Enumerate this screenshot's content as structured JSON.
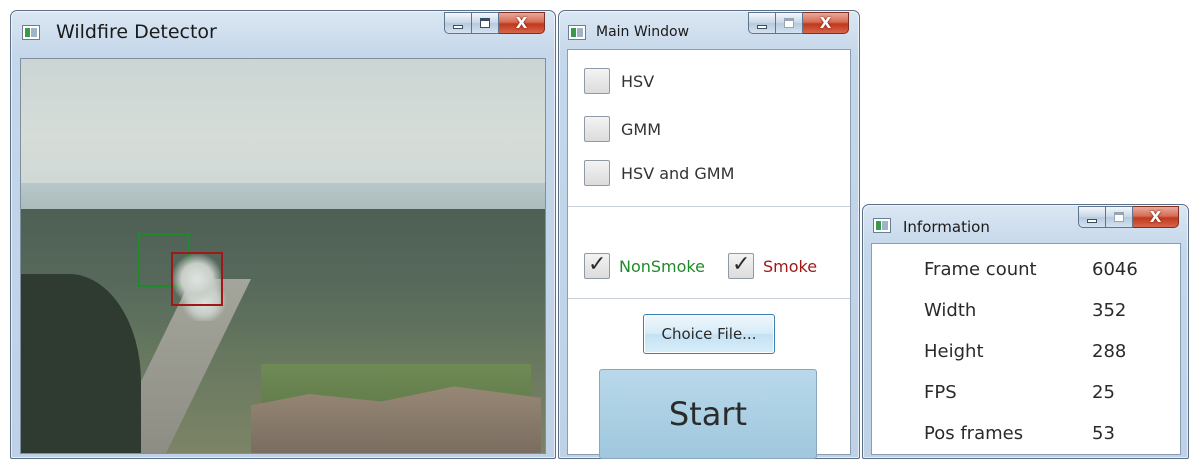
{
  "detector_window": {
    "title": "Wildfire Detector",
    "icon": "app-icon",
    "controls": [
      "minimize-icon",
      "maximize-icon",
      "close-icon"
    ],
    "close_glyph": "X",
    "detections": [
      {
        "label": "nonsmoke",
        "color": "#1f8a2b"
      },
      {
        "label": "smoke",
        "color": "#a01818"
      }
    ]
  },
  "main_window": {
    "title": "Main Window",
    "close_glyph": "X",
    "methods": [
      {
        "label": "HSV",
        "checked": false
      },
      {
        "label": "GMM",
        "checked": false
      },
      {
        "label": "HSV and GMM",
        "checked": false
      }
    ],
    "filters": [
      {
        "label": "NonSmoke",
        "checked": true,
        "color": "#1f8a2b"
      },
      {
        "label": "Smoke",
        "checked": true,
        "color": "#a01818"
      }
    ],
    "choice_button": "Choice File...",
    "start_button": "Start"
  },
  "info_window": {
    "title": "Information",
    "close_glyph": "X",
    "rows": [
      {
        "label": "Frame count",
        "value": "6046"
      },
      {
        "label": "Width",
        "value": "352"
      },
      {
        "label": "Height",
        "value": "288"
      },
      {
        "label": "FPS",
        "value": "25"
      },
      {
        "label": "Pos frames",
        "value": "53"
      }
    ]
  }
}
